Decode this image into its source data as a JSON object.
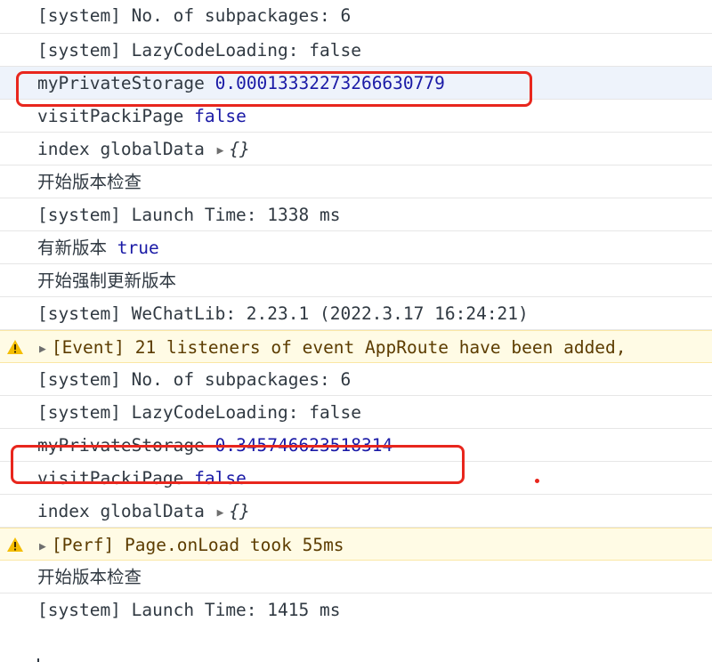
{
  "rows": [
    {
      "type": "log",
      "text": "[system] No. of subpackages: 6"
    },
    {
      "type": "log",
      "text": "[system] LazyCodeLoading: false"
    },
    {
      "type": "kv",
      "key": "myPrivateStorage",
      "value": "0.00013332273266630779",
      "highlight": true
    },
    {
      "type": "kv",
      "key": "visitPackiPage",
      "value": "false"
    },
    {
      "type": "obj",
      "key": "index globalData",
      "value": "{}"
    },
    {
      "type": "log",
      "text": "开始版本检查"
    },
    {
      "type": "log",
      "text": "[system] Launch Time: 1338 ms"
    },
    {
      "type": "kv",
      "key": "有新版本",
      "value": "true"
    },
    {
      "type": "log",
      "text": "开始强制更新版本"
    },
    {
      "type": "log",
      "text": "[system] WeChatLib: 2.23.1 (2022.3.17 16:24:21)"
    },
    {
      "type": "warn",
      "text": "[Event] 21 listeners of event AppRoute have been added,"
    },
    {
      "type": "log",
      "text": "[system] No. of subpackages: 6"
    },
    {
      "type": "log",
      "text": "[system] LazyCodeLoading: false"
    },
    {
      "type": "kv",
      "key": "myPrivateStorage",
      "value": "0.345746623518314",
      "highlight": true
    },
    {
      "type": "kv",
      "key": "visitPackiPage",
      "value": "false"
    },
    {
      "type": "obj",
      "key": "index globalData",
      "value": "{}"
    },
    {
      "type": "warn",
      "text": "[Perf] Page.onLoad took 55ms"
    },
    {
      "type": "log",
      "text": "开始版本检查"
    },
    {
      "type": "log",
      "text": "[system] Launch Time: 1415 ms"
    }
  ],
  "colors": {
    "annotation": "#e8261d",
    "value": "#1a1aa6",
    "warning_bg": "#fffbe5"
  }
}
